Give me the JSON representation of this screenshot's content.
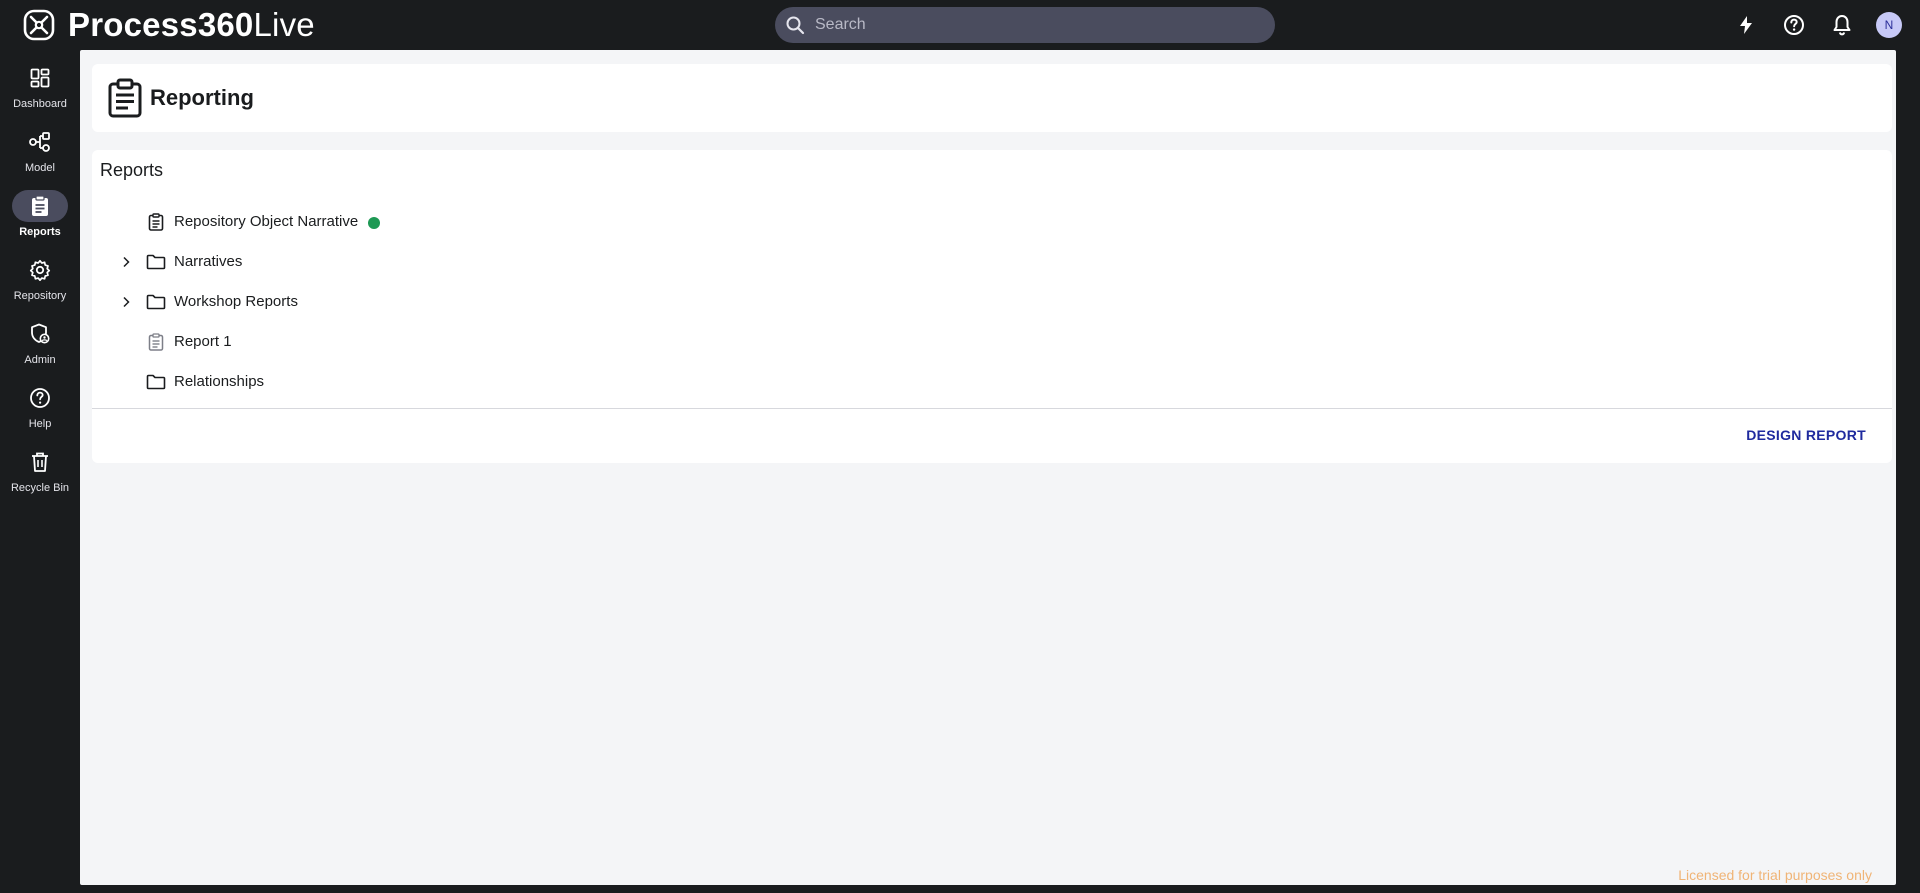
{
  "app": {
    "name_bold": "Process360",
    "name_light": "Live"
  },
  "search": {
    "placeholder": "Search"
  },
  "top_icons": [
    "bolt-icon",
    "help-circle-icon",
    "bell-icon"
  ],
  "user": {
    "avatar_initial": "N"
  },
  "sidebar": {
    "items": [
      {
        "label": "Dashboard",
        "icon": "dashboard-icon"
      },
      {
        "label": "Model",
        "icon": "model-icon"
      },
      {
        "label": "Reports",
        "icon": "clipboard-icon",
        "active": true
      },
      {
        "label": "Repository",
        "icon": "gear-icon"
      },
      {
        "label": "Admin",
        "icon": "admin-icon"
      },
      {
        "label": "Help",
        "icon": "help-circle-icon"
      },
      {
        "label": "Recycle Bin",
        "icon": "trash-icon"
      }
    ]
  },
  "page": {
    "title": "Reporting"
  },
  "reports": {
    "section_title": "Reports",
    "items": [
      {
        "label": "Repository Object Narrative",
        "type": "report",
        "status": "published"
      },
      {
        "label": "Narratives",
        "type": "folder",
        "expandable": true
      },
      {
        "label": "Workshop Reports",
        "type": "folder",
        "expandable": true
      },
      {
        "label": "Report 1",
        "type": "report-draft"
      },
      {
        "label": "Relationships",
        "type": "folder"
      }
    ],
    "design_button": "DESIGN REPORT"
  },
  "colors": {
    "status_published": "#1e9954",
    "accent": "#1f2a9e",
    "license_text": "#f0b476"
  },
  "footer": {
    "license": "Licensed for trial purposes only"
  }
}
